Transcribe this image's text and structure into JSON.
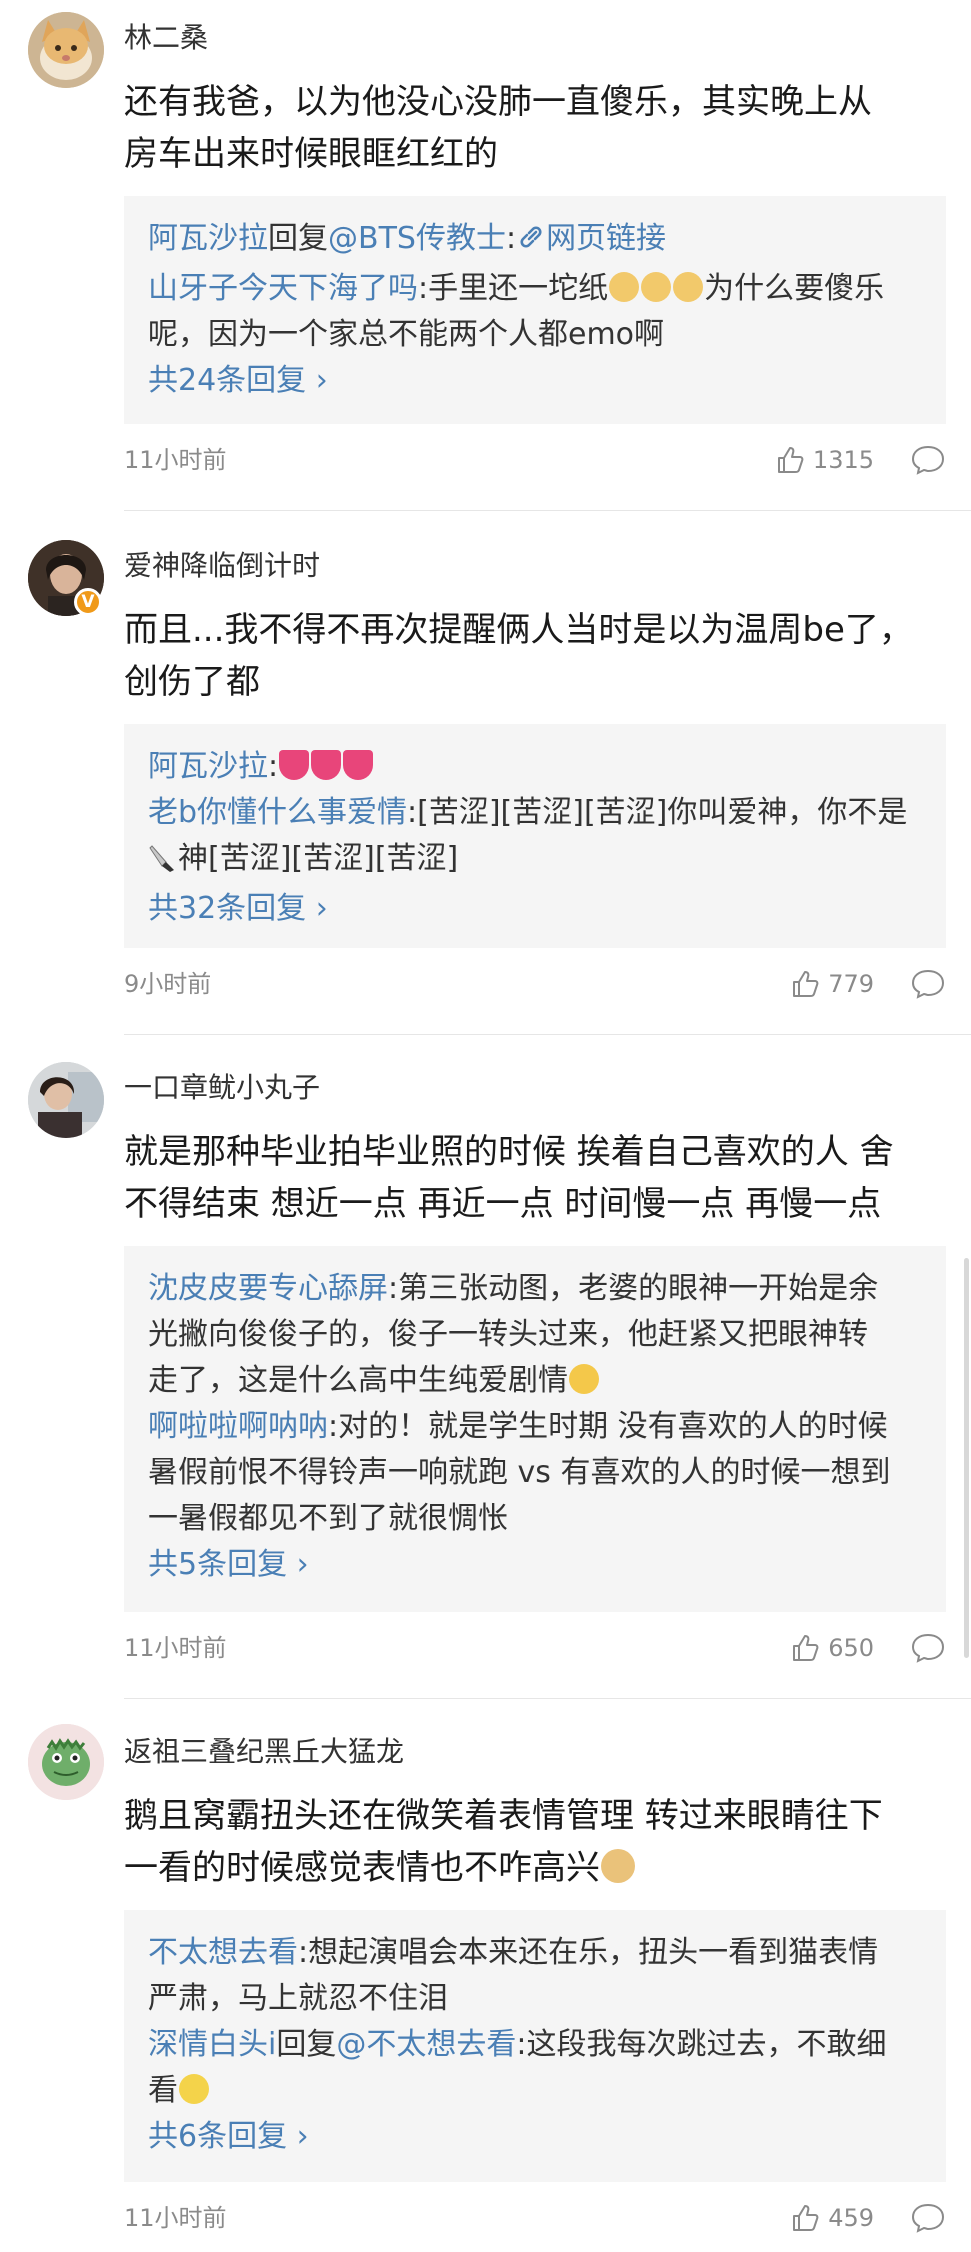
{
  "comments": [
    {
      "username": "林二桑",
      "body_lines": [
        "还有我爸，以为他没心没肺一直傻乐，其实晚上从",
        "房车出来时候眼眶红红的"
      ],
      "replies": {
        "r1_name": "阿瓦沙拉",
        "r1_mid": "回复",
        "r1_target": "@BTS传教士",
        "r1_colon": ":",
        "r1_link": "网页链接",
        "r2_name": "山牙子今天下海了吗",
        "r2_text_a": ":手里还一坨纸",
        "r2_text_b": "为什么要傻乐",
        "r2_line2": "呢，因为一个家总不能两个人都emo啊"
      },
      "more": "共24条回复 ›",
      "time": "11小时前",
      "likes": "1315"
    },
    {
      "username": "爱神降临倒计时",
      "badge": "V",
      "body_lines": [
        "而且...我不得不再次提醒俩人当时是以为温周be了，",
        "创伤了都"
      ],
      "replies": {
        "r1_name": "阿瓦沙拉",
        "r1_text": ":",
        "r2_name": "老b你懂什么事爱情",
        "r2_text": ":[苦涩][苦涩][苦涩]你叫爱神，你不是",
        "r2_line2": "神[苦涩][苦涩][苦涩]"
      },
      "more": "共32条回复 ›",
      "time": "9小时前",
      "likes": "779"
    },
    {
      "username": "一口章鱿小丸子",
      "body_lines": [
        "就是那种毕业拍毕业照的时候 挨着自己喜欢的人 舍",
        "不得结束 想近一点 再近一点 时间慢一点 再慢一点"
      ],
      "replies": {
        "r1_name": "沈皮皮要专心舔屏",
        "r1_text": ":第三张动图，老婆的眼神一开始是余",
        "r1_line2": "光撇向俊俊子的，俊子一转头过来，他赶紧又把眼神转",
        "r1_line3": "走了，这是什么高中生纯爱剧情",
        "r2_name": "啊啦啦啊呐呐",
        "r2_text": ":对的！就是学生时期 没有喜欢的人的时候",
        "r2_line2": "暑假前恨不得铃声一响就跑 vs 有喜欢的人的时候一想到",
        "r2_line3": "一暑假都见不到了就很惆怅"
      },
      "more": "共5条回复 ›",
      "time": "11小时前",
      "likes": "650"
    },
    {
      "username": "返祖三叠纪黑丘大猛龙",
      "body_lines": [
        "鹅且窝霸扭头还在微笑着表情管理 转过来眼睛往下",
        "一看的时候感觉表情也不咋高兴"
      ],
      "replies": {
        "r1_name": "不太想去看",
        "r1_text": ":想起演唱会本来还在乐，扭头一看到猫表情",
        "r1_line2": "严肃，马上就忍不住泪",
        "r2_name": "深情白头i",
        "r2_mid": "回复",
        "r2_target": "@不太想去看",
        "r2_text": ":这段我每次跳过去，不敢细",
        "r2_line2": "看"
      },
      "more": "共6条回复 ›",
      "time": "11小时前",
      "likes": "459"
    }
  ],
  "icons": {
    "like": "thumbs-up-icon",
    "reply": "comment-bubble-icon",
    "link": "link-icon",
    "badge": "verified-badge"
  },
  "colors": {
    "name_blue": "#4a7fb5",
    "reply_bg": "#f5f5f5",
    "meta_gray": "#8a8a8a",
    "badge_orange": "#f09a1a"
  }
}
